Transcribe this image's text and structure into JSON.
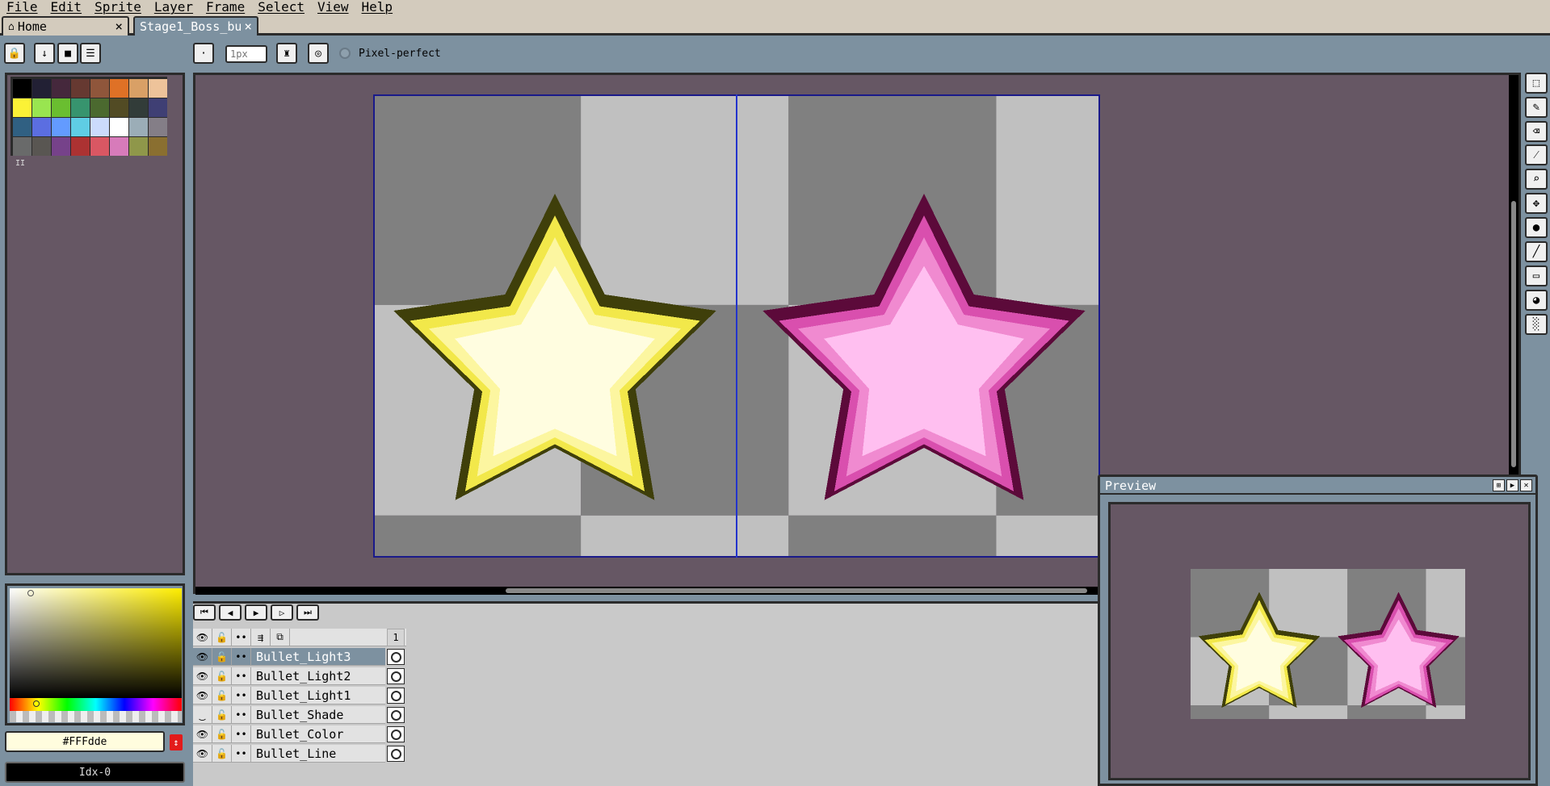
{
  "menu": [
    "File",
    "Edit",
    "Sprite",
    "Layer",
    "Frame",
    "Select",
    "View",
    "Help"
  ],
  "tabs": {
    "home": "Home",
    "sprite": "Stage1_Boss_bu",
    "close": "×"
  },
  "toolbar": {
    "brush_size_placeholder": "1px",
    "pixel_perfect_label": "Pixel-perfect"
  },
  "colors": {
    "fg_hex": "#FFFdde",
    "index_label": "Idx-0",
    "palette": [
      "#000000",
      "#222034",
      "#45283c",
      "#663931",
      "#8f563b",
      "#df7126",
      "#d9a066",
      "#eec39a",
      "#fbf236",
      "#99e550",
      "#6abe30",
      "#37946e",
      "#4b692f",
      "#524b24",
      "#323c39",
      "#3f3f74",
      "#306082",
      "#5b6ee1",
      "#639bff",
      "#5fcde4",
      "#cbdbfc",
      "#ffffff",
      "#9badb7",
      "#847e87",
      "#696a6a",
      "#595652",
      "#76428a",
      "#ac3232",
      "#d95763",
      "#d77bba",
      "#8f974a",
      "#8a6f30"
    ],
    "palette_marker": "II"
  },
  "timeline": {
    "frame_number": "1",
    "layers": [
      {
        "name": "Bullet_Light3",
        "selected": true,
        "visible": true
      },
      {
        "name": "Bullet_Light2",
        "selected": false,
        "visible": true
      },
      {
        "name": "Bullet_Light1",
        "selected": false,
        "visible": true
      },
      {
        "name": "Bullet_Shade",
        "selected": false,
        "visible": false
      },
      {
        "name": "Bullet_Color",
        "selected": false,
        "visible": true
      },
      {
        "name": "Bullet_Line",
        "selected": false,
        "visible": true
      }
    ]
  },
  "preview": {
    "title": "Preview"
  },
  "sprite_colors": {
    "checker_dark": "#808080",
    "checker_light": "#c0c0c0",
    "yellow_outline": "#3f3f0a",
    "yellow_mid": "#f2e84a",
    "yellow_light": "#fcf6a0",
    "yellow_core": "#fffde0",
    "pink_outline": "#5c0a3a",
    "pink_mid": "#d94fae",
    "pink_light": "#f08ad0",
    "pink_core": "#ffbff0"
  }
}
